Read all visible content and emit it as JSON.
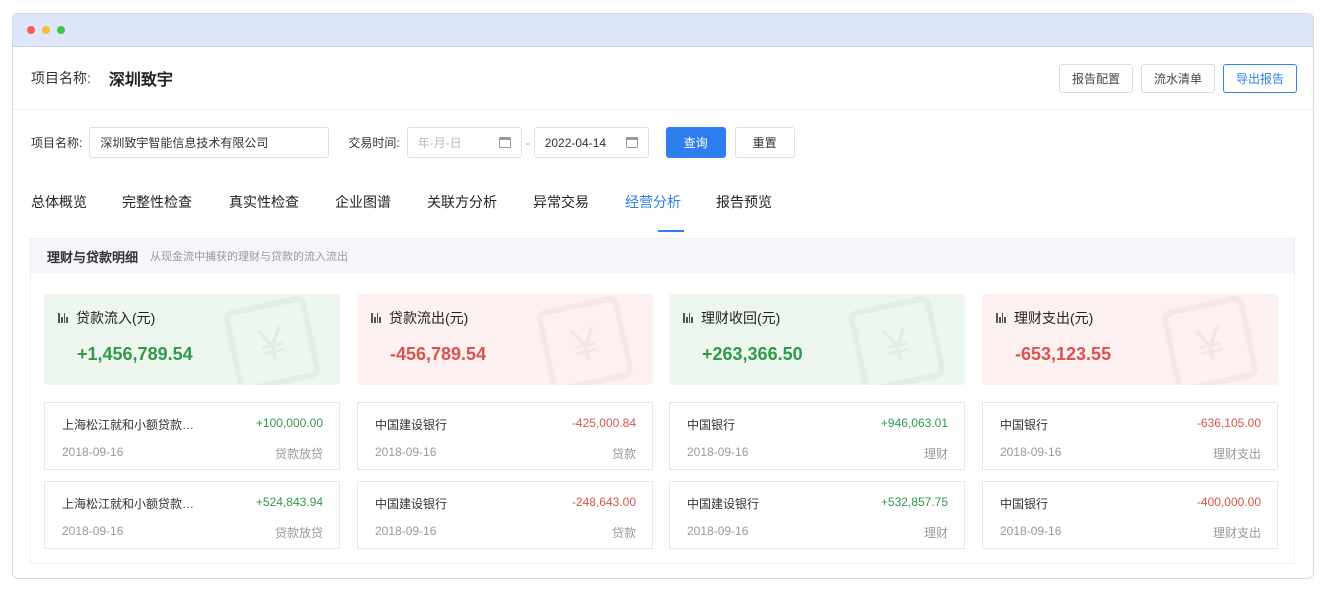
{
  "window": {
    "dots": [
      "#f25f58",
      "#fbbe2e",
      "#39c84a"
    ]
  },
  "header": {
    "project_label": "项目名称:",
    "project_name": "深圳致宇",
    "buttons": [
      "报告配置",
      "流水清单",
      "导出报告"
    ]
  },
  "filters": {
    "project_label": "项目名称:",
    "project_value": "深圳致宇智能信息技术有限公司",
    "time_label": "交易时间:",
    "start_placeholder": "年-月-日",
    "separator": "-",
    "end_value": "2022-04-14",
    "query_label": "查询",
    "reset_label": "重置"
  },
  "tabs": [
    {
      "label": "总体概览",
      "active": false
    },
    {
      "label": "完整性检查",
      "active": false
    },
    {
      "label": "真实性检查",
      "active": false
    },
    {
      "label": "企业图谱",
      "active": false
    },
    {
      "label": "关联方分析",
      "active": false
    },
    {
      "label": "异常交易",
      "active": false
    },
    {
      "label": "经营分析",
      "active": true
    },
    {
      "label": "报告预览",
      "active": false
    }
  ],
  "panel": {
    "title": "理财与贷款明细",
    "subtitle": "从现金流中捕获的理财与贷款的流入流出"
  },
  "stats": [
    {
      "label": "贷款流入(元)",
      "value": "+1,456,789.54",
      "tone": "green"
    },
    {
      "label": "贷款流出(元)",
      "value": "-456,789.54",
      "tone": "red"
    },
    {
      "label": "理财收回(元)",
      "value": "+263,366.50",
      "tone": "green"
    },
    {
      "label": "理财支出(元)",
      "value": "-653,123.55",
      "tone": "red"
    }
  ],
  "cards": [
    [
      {
        "name": "上海松江就和小额贷款…",
        "amount": "+100,000.00",
        "date": "2018-09-16",
        "type": "贷款放贷"
      },
      {
        "name": "上海松江就和小额贷款…",
        "amount": "+524,843.94",
        "date": "2018-09-16",
        "type": "贷款放贷"
      }
    ],
    [
      {
        "name": "中国建设银行",
        "amount": "-425,000.84",
        "date": "2018-09-16",
        "type": "贷款"
      },
      {
        "name": "中国建设银行",
        "amount": "-248,643.00",
        "date": "2018-09-16",
        "type": "贷款"
      }
    ],
    [
      {
        "name": "中国银行",
        "amount": "+946,063.01",
        "date": "2018-09-16",
        "type": "理财"
      },
      {
        "name": "中国建设银行",
        "amount": "+532,857.75",
        "date": "2018-09-16",
        "type": "理财"
      }
    ],
    [
      {
        "name": "中国银行",
        "amount": "-636,105.00",
        "date": "2018-09-16",
        "type": "理财支出"
      },
      {
        "name": "中国银行",
        "amount": "-400,000.00",
        "date": "2018-09-16",
        "type": "理财支出"
      }
    ]
  ],
  "icons": {
    "stat": "bars-icon",
    "date": "calendar-icon",
    "watermark": "yuan-exchange-icon"
  }
}
